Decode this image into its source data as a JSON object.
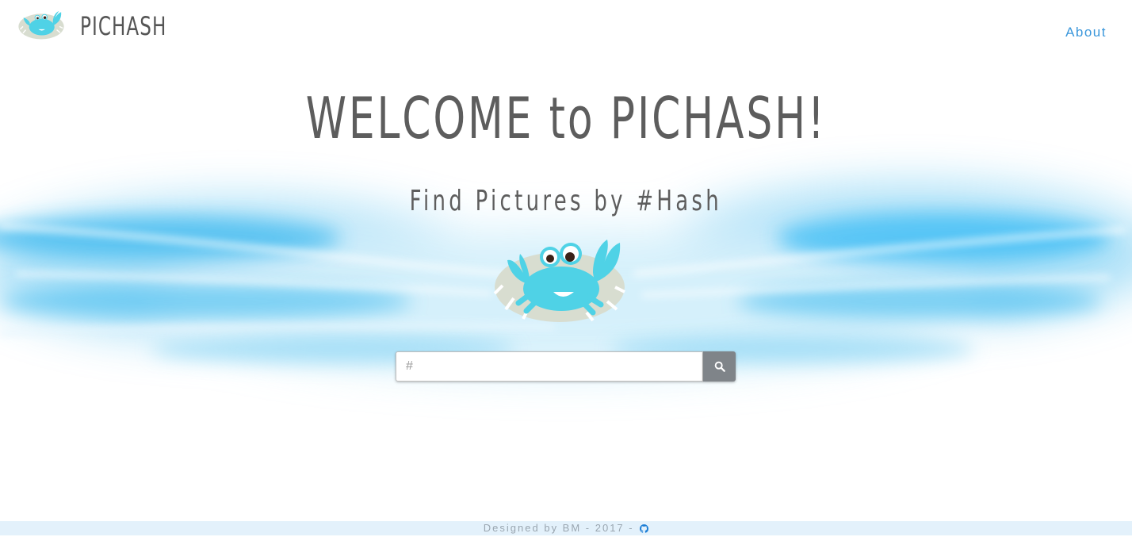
{
  "header": {
    "brand": "PICHASH",
    "nav_about": "About"
  },
  "hero": {
    "title": "WELCOME to PICHASH!",
    "subtitle": "Find Pictures by #Hash"
  },
  "search": {
    "placeholder": "#",
    "value": "",
    "button_icon": "search-icon"
  },
  "footer": {
    "text": "Designed by BM - 2017 - ",
    "icon": "github-icon"
  },
  "colors": {
    "accent_link": "#3b97db",
    "crab": "#4fd2e6",
    "title_text": "#5d5d5d",
    "search_button": "#7f8489",
    "footer_bg": "#e3f1fb"
  }
}
